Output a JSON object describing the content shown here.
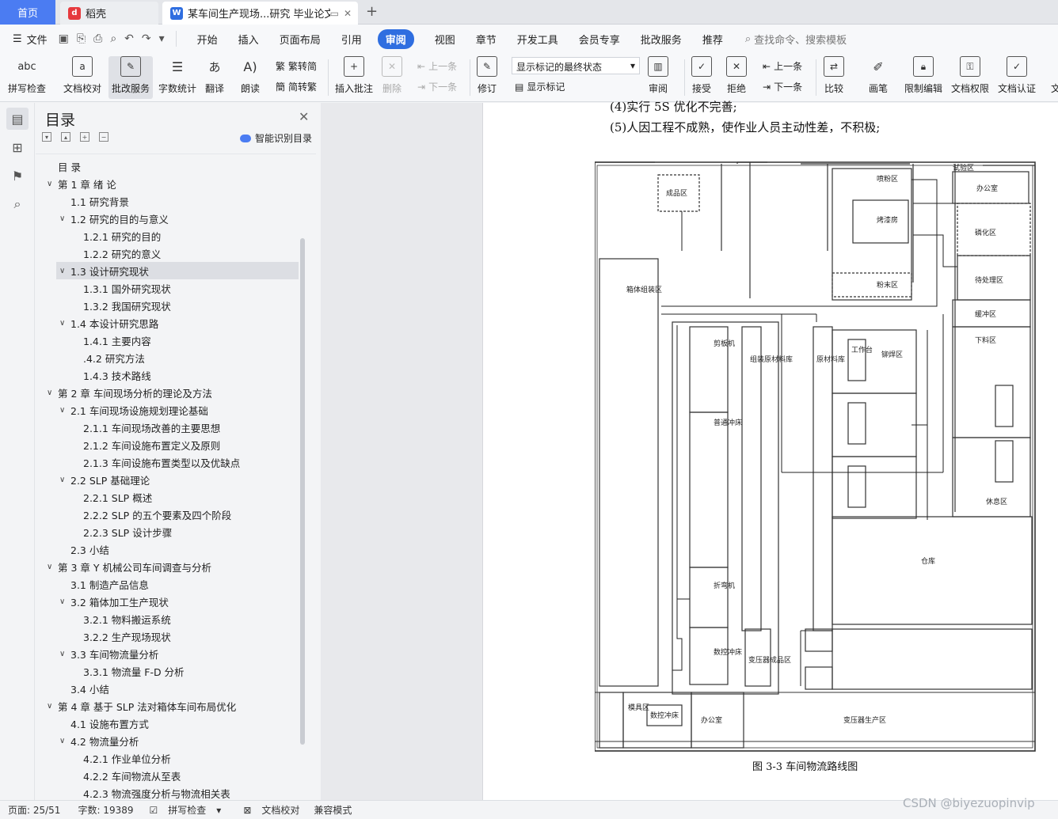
{
  "tabs": {
    "home": "首页",
    "daoke": "稻壳",
    "doc": "某车间生产现场...研究 毕业论文"
  },
  "menu": {
    "file": "文件",
    "items": [
      "开始",
      "插入",
      "页面布局",
      "引用",
      "审阅",
      "视图",
      "章节",
      "开发工具",
      "会员专享",
      "批改服务",
      "推荐"
    ],
    "search": "查找命令、搜索模板"
  },
  "ribbon": {
    "spell": "拼写检查",
    "proof": "文档校对",
    "review_service": "批改服务",
    "wordcount": "字数统计",
    "translate": "翻译",
    "read": "朗读",
    "trad": "繁转简",
    "simp": "简转繁",
    "insert_comment": "插入批注",
    "delete": "删除",
    "prev1": "上一条",
    "next1": "下一条",
    "revise": "修订",
    "markup_state": "显示标记的最终状态",
    "show_markup": "显示标记",
    "review": "审阅",
    "accept": "接受",
    "reject": "拒绝",
    "prev2": "上一条",
    "next2": "下一条",
    "compare": "比较",
    "pen": "画笔",
    "restrict": "限制编辑",
    "perm": "文档权限",
    "cert": "文档认证",
    "more": "文"
  },
  "toc": {
    "title": "目录",
    "smart": "智能识别目录",
    "items": [
      {
        "text": "目  录",
        "level": 0,
        "chev": ""
      },
      {
        "text": "第 1 章  绪   论",
        "level": 0,
        "chev": "v"
      },
      {
        "text": "1.1  研究背景",
        "level": 1,
        "chev": ""
      },
      {
        "text": "1.2  研究的目的与意义",
        "level": 1,
        "chev": "v"
      },
      {
        "text": "1.2.1  研究的目的",
        "level": 2,
        "chev": ""
      },
      {
        "text": "1.2.2  研究的意义",
        "level": 2,
        "chev": ""
      },
      {
        "text": "1.3  设计研究现状",
        "level": 1,
        "chev": "v",
        "selected": true
      },
      {
        "text": "1.3.1  国外研究现状",
        "level": 2,
        "chev": ""
      },
      {
        "text": "1.3.2  我国研究现状",
        "level": 2,
        "chev": ""
      },
      {
        "text": "1.4  本设计研究思路",
        "level": 1,
        "chev": "v"
      },
      {
        "text": "1.4.1  主要内容",
        "level": 2,
        "chev": ""
      },
      {
        "text": ".4.2  研究方法",
        "level": 2,
        "chev": ""
      },
      {
        "text": "1.4.3  技术路线",
        "level": 2,
        "chev": ""
      },
      {
        "text": "第 2 章  车间现场分析的理论及方法",
        "level": 0,
        "chev": "v"
      },
      {
        "text": "2.1  车间现场设施规划理论基础",
        "level": 1,
        "chev": "v"
      },
      {
        "text": "2.1.1  车间现场改善的主要思想",
        "level": 2,
        "chev": ""
      },
      {
        "text": "2.1.2  车间设施布置定义及原则",
        "level": 2,
        "chev": ""
      },
      {
        "text": "2.1.3  车间设施布置类型以及优缺点",
        "level": 2,
        "chev": ""
      },
      {
        "text": "2.2 SLP  基础理论",
        "level": 1,
        "chev": "v"
      },
      {
        "text": "2.2.1 SLP  概述",
        "level": 2,
        "chev": ""
      },
      {
        "text": "2.2.2 SLP  的五个要素及四个阶段",
        "level": 2,
        "chev": ""
      },
      {
        "text": "2.2.3 SLP  设计步骤",
        "level": 2,
        "chev": ""
      },
      {
        "text": "2.3  小结",
        "level": 1,
        "chev": ""
      },
      {
        "text": "第 3 章  Y 机械公司车间调查与分析",
        "level": 0,
        "chev": "v"
      },
      {
        "text": "3.1  制造产品信息",
        "level": 1,
        "chev": ""
      },
      {
        "text": "3.2  箱体加工生产现状",
        "level": 1,
        "chev": "v"
      },
      {
        "text": "3.2.1  物料搬运系统",
        "level": 2,
        "chev": ""
      },
      {
        "text": "3.2.2  生产现场现状",
        "level": 2,
        "chev": ""
      },
      {
        "text": "3.3  车间物流量分析",
        "level": 1,
        "chev": "v"
      },
      {
        "text": "3.3.1  物流量 F-D 分析",
        "level": 2,
        "chev": ""
      },
      {
        "text": "3.4  小结",
        "level": 1,
        "chev": ""
      },
      {
        "text": "第 4 章  基于 SLP 法对箱体车间布局优化",
        "level": 0,
        "chev": "v"
      },
      {
        "text": "4.1  设施布置方式",
        "level": 1,
        "chev": ""
      },
      {
        "text": "4.2  物流量分析",
        "level": 1,
        "chev": "v"
      },
      {
        "text": "4.2.1  作业单位分析",
        "level": 2,
        "chev": ""
      },
      {
        "text": "4.2.2  车间物流从至表",
        "level": 2,
        "chev": ""
      },
      {
        "text": "4.2.3  物流强度分析与物流相关表",
        "level": 2,
        "chev": ""
      }
    ]
  },
  "doc": {
    "line1": "(4)实行 5S 优化不完善;",
    "line2": "(5)人因工程不成熟，使作业人员主动性差，不积极;",
    "caption": "图 3-3    车间物流路线图",
    "fig": {
      "product": "成品区",
      "spray": "喷粉区",
      "bake": "烤漆房",
      "powder": "粉末区",
      "test": "试验区",
      "office1": "办公室",
      "phos": "磷化区",
      "pending": "待处理区",
      "box": "箱体组装区",
      "buffer": "缓冲区",
      "blank": "下料区",
      "shear": "剪板机",
      "assy_mat": "组装原材料库",
      "raw": "原材料库",
      "workbench": "工作台",
      "rivet": "铆焊区",
      "press": "普通冲床",
      "bend": "折弯机",
      "cnc": "数控冲床",
      "rest": "休息区",
      "warehouse": "仓库",
      "xf_prod": "变压器成品区",
      "mold": "模具区",
      "cnc_press": "数控冲床",
      "office2": "办公室",
      "xf_line": "变压器生产区"
    }
  },
  "status": {
    "page": "页面: 25/51",
    "words": "字数: 19389",
    "spell": "拼写检查",
    "proof": "文档校对",
    "compat": "兼容模式"
  },
  "watermark": "CSDN @biyezuopinvip"
}
